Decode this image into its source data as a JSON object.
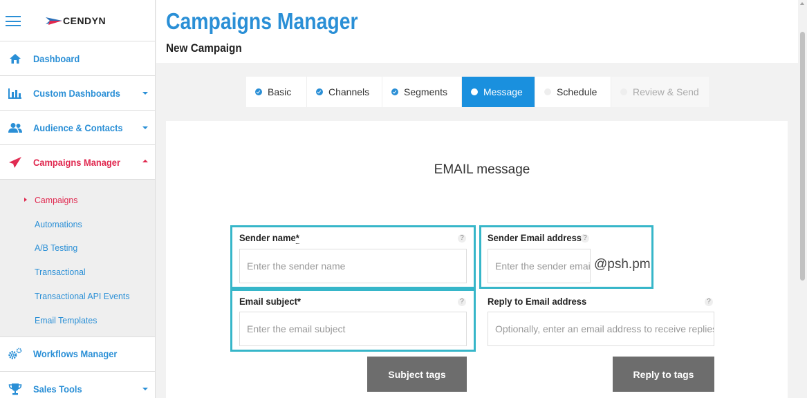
{
  "app": {
    "logo_text": "CENDYN",
    "accent_color": "#2a8fd6",
    "active_color": "#e0284f",
    "highlight_color": "#36b6c9"
  },
  "sidebar": {
    "items": [
      {
        "label": "Dashboard",
        "icon": "home-icon"
      },
      {
        "label": "Custom Dashboards",
        "icon": "bar-chart-icon"
      },
      {
        "label": "Audience & Contacts",
        "icon": "people-icon"
      },
      {
        "label": "Campaigns Manager",
        "icon": "paper-plane-icon"
      },
      {
        "label": "Workflows Manager",
        "icon": "gears-icon"
      },
      {
        "label": "Sales Tools",
        "icon": "trophy-icon"
      }
    ],
    "sub_items": [
      {
        "label": "Campaigns"
      },
      {
        "label": "Automations"
      },
      {
        "label": "A/B Testing"
      },
      {
        "label": "Transactional"
      },
      {
        "label": "Transactional API Events"
      },
      {
        "label": "Email Templates"
      }
    ]
  },
  "page": {
    "title": "Campaigns Manager",
    "subtitle": "New Campaign"
  },
  "steps": [
    {
      "label": "Basic",
      "state": "done"
    },
    {
      "label": "Channels",
      "state": "done"
    },
    {
      "label": "Segments",
      "state": "done"
    },
    {
      "label": "Message",
      "state": "current"
    },
    {
      "label": "Schedule",
      "state": "future"
    },
    {
      "label": "Review & Send",
      "state": "disabled"
    }
  ],
  "form": {
    "title": "EMAIL message",
    "sender_name": {
      "label": "Sender name",
      "required_mark": "*",
      "placeholder": "Enter the sender name",
      "value": ""
    },
    "sender_email": {
      "label": "Sender Email address*",
      "placeholder": "Enter the sender email",
      "value": "",
      "domain": "@psh.pm"
    },
    "email_subject": {
      "label": "Email subject*",
      "placeholder": "Enter the email subject",
      "value": ""
    },
    "reply_to": {
      "label": "Reply to Email address",
      "placeholder": "Optionally, enter an email address to receive replies",
      "value": ""
    },
    "help_glyph": "?",
    "subject_tags_label": "Subject tags",
    "reply_tags_label": "Reply to tags"
  }
}
